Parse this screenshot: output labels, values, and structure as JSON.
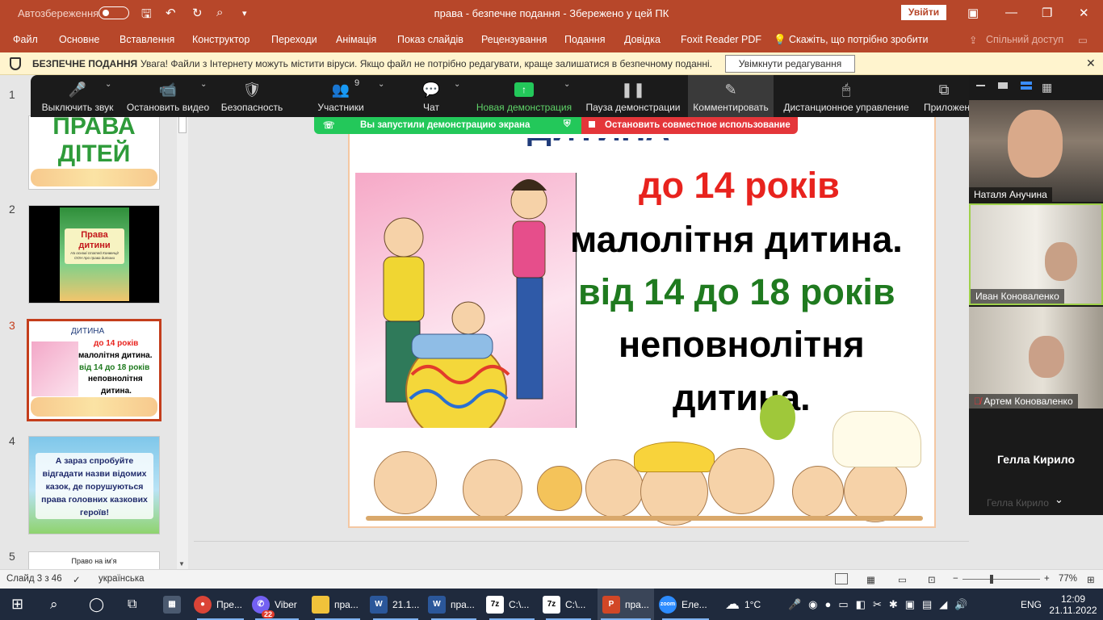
{
  "titlebar": {
    "autosave_label": "Автозбереження",
    "title": "права  -  безпечне подання  -  Збережено у цей ПК",
    "signin": "Увійти"
  },
  "menu": [
    "Файл",
    "Основне",
    "Вставлення",
    "Конструктор",
    "Переходи",
    "Анімація",
    "Показ слайдів",
    "Рецензування",
    "Подання",
    "Довідка",
    "Foxit Reader PDF",
    "Скажіть, що потрібно зробити",
    "Спільний доступ"
  ],
  "infobar": {
    "label": "БЕЗПЕЧНЕ ПОДАННЯ",
    "message": "Увага! Файли з Інтернету можуть містити віруси. Якщо файл не потрібно редагувати, краще залишатися в безпечному поданні.",
    "button": "Увімкнути редагування"
  },
  "thumbnails": [
    {
      "num": "1",
      "text": "ПРАВА ДІТЕЙ"
    },
    {
      "num": "2",
      "title": "Права дитини",
      "sub": "На основі статей Конвенції ООН про права дитини"
    },
    {
      "num": "3",
      "title": "ДИТИНА",
      "l1": "до 14 років",
      "l2": "малолітня дитина.",
      "l3": "від 14 до 18 років",
      "l4": "неповнолітня",
      "l5": "дитина."
    },
    {
      "num": "4",
      "text": "А зараз спробуйте відгадати назви відомих казок, де порушуються права головних казкових героїв!"
    },
    {
      "num": "5",
      "text": "Право на ім'я"
    }
  ],
  "slide": {
    "title_partial": "ДИТИНА",
    "line1": "до 14 років",
    "line2": "малолітня дитина.",
    "line3": "від 14 до 18 років",
    "line4": "неповнолітня",
    "line5": "дитина."
  },
  "zoom": {
    "buttons": [
      {
        "label": "Выключить звук",
        "icon": "microphone-icon"
      },
      {
        "label": "Остановить видео",
        "icon": "camera-icon"
      },
      {
        "label": "Безопасность",
        "icon": "shield-icon"
      },
      {
        "label": "Участники",
        "icon": "participants-icon",
        "count": "9"
      },
      {
        "label": "Чат",
        "icon": "chat-icon"
      },
      {
        "label": "Новая демонстрация",
        "icon": "share-icon"
      },
      {
        "label": "Пауза демонстрации",
        "icon": "pause-icon"
      },
      {
        "label": "Комментировать",
        "icon": "pen-icon"
      },
      {
        "label": "Дистанционное управление",
        "icon": "mouse-icon"
      },
      {
        "label": "Приложен",
        "icon": "apps-icon"
      }
    ],
    "share_banner": "Вы запустили демонстрацию экрана",
    "stop_banner": "Остановить совместное использование",
    "participants": [
      "Наталя Анучина",
      "Иван Коноваленко",
      "Артем Коноваленко",
      "Гелла Кирило",
      "Гелла Кирило"
    ]
  },
  "status": {
    "slide": "Слайд 3 з 46",
    "lang": "українська",
    "zoom": "77%"
  },
  "taskbar": {
    "items": [
      "Пре...",
      "Viber",
      "пра...",
      "21.1...",
      "пра...",
      "C:\\...",
      "C:\\...",
      "пра...",
      "Еле..."
    ],
    "viber_badge": "22",
    "weather": "1°C",
    "lang": "ENG",
    "time": "12:09",
    "date": "21.11.2022"
  },
  "colors": {
    "accent": "#b7472a",
    "red": "#e8231e",
    "green": "#1f7a1f",
    "zoom_green": "#23c85a"
  }
}
